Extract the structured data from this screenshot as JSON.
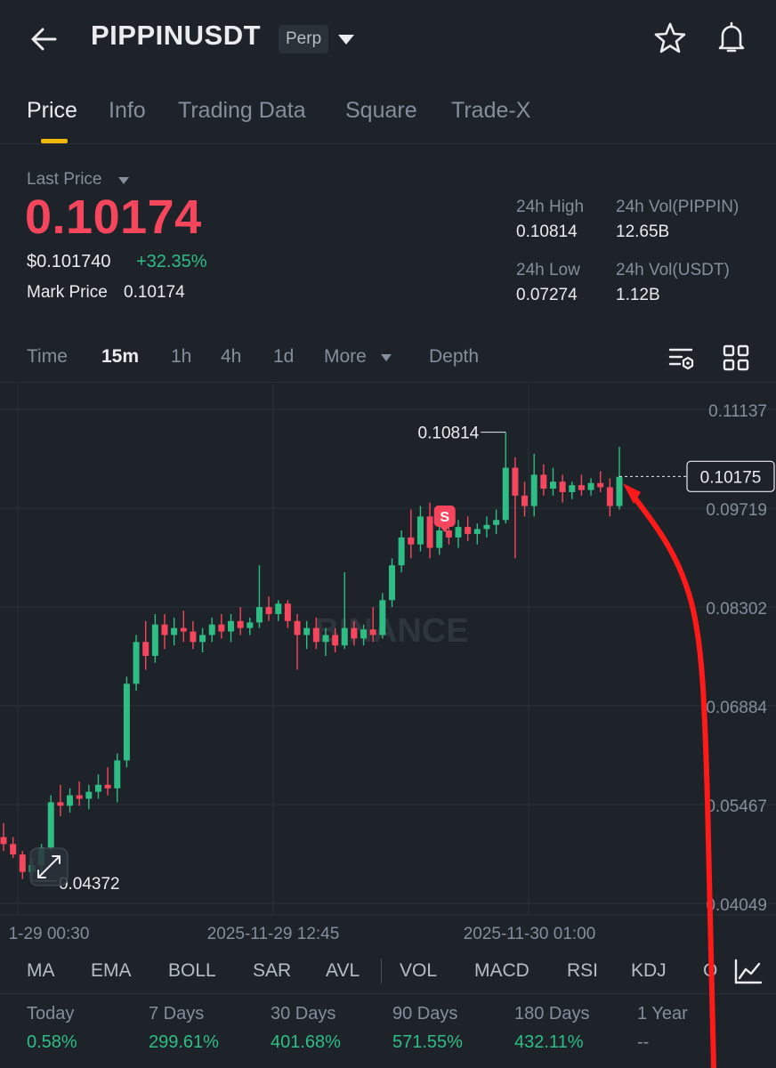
{
  "header": {
    "symbol": "PIPPINUSDT",
    "badge": "Perp",
    "icons": [
      "back-arrow-icon",
      "chevron-down-icon",
      "star-icon",
      "bell-icon"
    ]
  },
  "tabs": [
    {
      "label": "Price",
      "active": true
    },
    {
      "label": "Info",
      "active": false
    },
    {
      "label": "Trading Data",
      "active": false
    },
    {
      "label": "Square",
      "active": false
    },
    {
      "label": "Trade-X",
      "active": false
    }
  ],
  "price": {
    "last_price_label": "Last Price",
    "last_price": "0.10174",
    "usd_price": "$0.101740",
    "change": "+32.35%",
    "mark_label": "Mark Price",
    "mark_value": "0.10174"
  },
  "stats": {
    "high_label": "24h High",
    "high_value": "0.10814",
    "vol_base_label": "24h Vol(PIPPIN)",
    "vol_base_value": "12.65B",
    "low_label": "24h Low",
    "low_value": "0.07274",
    "vol_quote_label": "24h Vol(USDT)",
    "vol_quote_value": "1.12B"
  },
  "intervals": {
    "items": [
      {
        "label": "Time",
        "active": false
      },
      {
        "label": "15m",
        "active": true
      },
      {
        "label": "1h",
        "active": false
      },
      {
        "label": "4h",
        "active": false
      },
      {
        "label": "1d",
        "active": false
      },
      {
        "label": "More",
        "active": false
      },
      {
        "label": "Depth",
        "active": false
      }
    ]
  },
  "chart_data": {
    "type": "candlestick",
    "y_ticks": [
      "0.11137",
      "0.09719",
      "0.08302",
      "0.06884",
      "0.05467",
      "0.04049"
    ],
    "x_ticks": [
      "1-29 00:30",
      "2025-11-29 12:45",
      "2025-11-30 01:00"
    ],
    "ylim": [
      0.04049,
      0.11137
    ],
    "max_label": "0.10814",
    "min_label": "0.04372",
    "current_price_label": "0.10175",
    "marker_label": "S",
    "watermark": "BINANCE",
    "up_color": "#2ebd85",
    "down_color": "#f6465d",
    "candles": [
      {
        "o": 0.05,
        "h": 0.052,
        "l": 0.048,
        "c": 0.049
      },
      {
        "o": 0.049,
        "h": 0.05,
        "l": 0.047,
        "c": 0.0475
      },
      {
        "o": 0.0475,
        "h": 0.048,
        "l": 0.044,
        "c": 0.045
      },
      {
        "o": 0.045,
        "h": 0.047,
        "l": 0.0437,
        "c": 0.046
      },
      {
        "o": 0.046,
        "h": 0.049,
        "l": 0.045,
        "c": 0.0485
      },
      {
        "o": 0.0485,
        "h": 0.056,
        "l": 0.048,
        "c": 0.055
      },
      {
        "o": 0.055,
        "h": 0.0575,
        "l": 0.053,
        "c": 0.0545
      },
      {
        "o": 0.0545,
        "h": 0.057,
        "l": 0.0535,
        "c": 0.056
      },
      {
        "o": 0.056,
        "h": 0.058,
        "l": 0.0545,
        "c": 0.0555
      },
      {
        "o": 0.0555,
        "h": 0.0575,
        "l": 0.054,
        "c": 0.0565
      },
      {
        "o": 0.0565,
        "h": 0.059,
        "l": 0.0555,
        "c": 0.0575
      },
      {
        "o": 0.0575,
        "h": 0.06,
        "l": 0.056,
        "c": 0.057
      },
      {
        "o": 0.057,
        "h": 0.062,
        "l": 0.055,
        "c": 0.061
      },
      {
        "o": 0.061,
        "h": 0.073,
        "l": 0.06,
        "c": 0.072
      },
      {
        "o": 0.072,
        "h": 0.079,
        "l": 0.071,
        "c": 0.078
      },
      {
        "o": 0.078,
        "h": 0.081,
        "l": 0.074,
        "c": 0.076
      },
      {
        "o": 0.076,
        "h": 0.082,
        "l": 0.075,
        "c": 0.0805
      },
      {
        "o": 0.0805,
        "h": 0.082,
        "l": 0.077,
        "c": 0.079
      },
      {
        "o": 0.079,
        "h": 0.0815,
        "l": 0.0775,
        "c": 0.08
      },
      {
        "o": 0.08,
        "h": 0.0825,
        "l": 0.078,
        "c": 0.0795
      },
      {
        "o": 0.0795,
        "h": 0.081,
        "l": 0.077,
        "c": 0.078
      },
      {
        "o": 0.078,
        "h": 0.08,
        "l": 0.0765,
        "c": 0.079
      },
      {
        "o": 0.079,
        "h": 0.0815,
        "l": 0.078,
        "c": 0.0805
      },
      {
        "o": 0.0805,
        "h": 0.082,
        "l": 0.0785,
        "c": 0.0795
      },
      {
        "o": 0.0795,
        "h": 0.082,
        "l": 0.078,
        "c": 0.081
      },
      {
        "o": 0.081,
        "h": 0.083,
        "l": 0.079,
        "c": 0.08
      },
      {
        "o": 0.08,
        "h": 0.0815,
        "l": 0.079,
        "c": 0.0808
      },
      {
        "o": 0.0808,
        "h": 0.089,
        "l": 0.08,
        "c": 0.083
      },
      {
        "o": 0.083,
        "h": 0.0845,
        "l": 0.081,
        "c": 0.082
      },
      {
        "o": 0.082,
        "h": 0.084,
        "l": 0.081,
        "c": 0.0835
      },
      {
        "o": 0.0835,
        "h": 0.084,
        "l": 0.08,
        "c": 0.081
      },
      {
        "o": 0.081,
        "h": 0.082,
        "l": 0.074,
        "c": 0.079
      },
      {
        "o": 0.079,
        "h": 0.081,
        "l": 0.077,
        "c": 0.08
      },
      {
        "o": 0.08,
        "h": 0.0815,
        "l": 0.077,
        "c": 0.078
      },
      {
        "o": 0.078,
        "h": 0.08,
        "l": 0.076,
        "c": 0.079
      },
      {
        "o": 0.079,
        "h": 0.08,
        "l": 0.0765,
        "c": 0.0775
      },
      {
        "o": 0.0775,
        "h": 0.088,
        "l": 0.077,
        "c": 0.08
      },
      {
        "o": 0.08,
        "h": 0.081,
        "l": 0.0775,
        "c": 0.0785
      },
      {
        "o": 0.0785,
        "h": 0.0805,
        "l": 0.0775,
        "c": 0.0798
      },
      {
        "o": 0.0798,
        "h": 0.083,
        "l": 0.078,
        "c": 0.079
      },
      {
        "o": 0.079,
        "h": 0.085,
        "l": 0.0785,
        "c": 0.084
      },
      {
        "o": 0.084,
        "h": 0.09,
        "l": 0.083,
        "c": 0.089
      },
      {
        "o": 0.089,
        "h": 0.094,
        "l": 0.088,
        "c": 0.093
      },
      {
        "o": 0.093,
        "h": 0.097,
        "l": 0.09,
        "c": 0.092
      },
      {
        "o": 0.092,
        "h": 0.0975,
        "l": 0.091,
        "c": 0.096
      },
      {
        "o": 0.096,
        "h": 0.098,
        "l": 0.09,
        "c": 0.0915
      },
      {
        "o": 0.0915,
        "h": 0.095,
        "l": 0.0905,
        "c": 0.094
      },
      {
        "o": 0.094,
        "h": 0.096,
        "l": 0.092,
        "c": 0.093
      },
      {
        "o": 0.093,
        "h": 0.0955,
        "l": 0.0915,
        "c": 0.0945
      },
      {
        "o": 0.0945,
        "h": 0.096,
        "l": 0.0925,
        "c": 0.0935
      },
      {
        "o": 0.0935,
        "h": 0.095,
        "l": 0.092,
        "c": 0.0942
      },
      {
        "o": 0.0942,
        "h": 0.096,
        "l": 0.093,
        "c": 0.0948
      },
      {
        "o": 0.0948,
        "h": 0.097,
        "l": 0.0935,
        "c": 0.0955
      },
      {
        "o": 0.0955,
        "h": 0.1081,
        "l": 0.095,
        "c": 0.103
      },
      {
        "o": 0.103,
        "h": 0.1045,
        "l": 0.09,
        "c": 0.099
      },
      {
        "o": 0.099,
        "h": 0.101,
        "l": 0.096,
        "c": 0.0975
      },
      {
        "o": 0.0975,
        "h": 0.105,
        "l": 0.096,
        "c": 0.102
      },
      {
        "o": 0.102,
        "h": 0.1035,
        "l": 0.099,
        "c": 0.1
      },
      {
        "o": 0.1,
        "h": 0.103,
        "l": 0.099,
        "c": 0.101
      },
      {
        "o": 0.101,
        "h": 0.102,
        "l": 0.098,
        "c": 0.0995
      },
      {
        "o": 0.0995,
        "h": 0.101,
        "l": 0.0985,
        "c": 0.1005
      },
      {
        "o": 0.1005,
        "h": 0.102,
        "l": 0.099,
        "c": 0.0998
      },
      {
        "o": 0.0998,
        "h": 0.1015,
        "l": 0.099,
        "c": 0.1008
      },
      {
        "o": 0.1008,
        "h": 0.1025,
        "l": 0.0995,
        "c": 0.1002
      },
      {
        "o": 0.1002,
        "h": 0.1015,
        "l": 0.096,
        "c": 0.0975
      },
      {
        "o": 0.0975,
        "h": 0.106,
        "l": 0.097,
        "c": 0.1017
      }
    ]
  },
  "indicators": {
    "items": [
      "MA",
      "EMA",
      "BOLL",
      "SAR",
      "AVL",
      "VOL",
      "MACD",
      "RSI",
      "KDJ",
      "O"
    ]
  },
  "performance": [
    {
      "label": "Today",
      "value": "0.58%"
    },
    {
      "label": "7 Days",
      "value": "299.61%"
    },
    {
      "label": "30 Days",
      "value": "401.68%"
    },
    {
      "label": "90 Days",
      "value": "571.55%"
    },
    {
      "label": "180 Days",
      "value": "432.11%"
    },
    {
      "label": "1 Year",
      "value": "--"
    }
  ]
}
